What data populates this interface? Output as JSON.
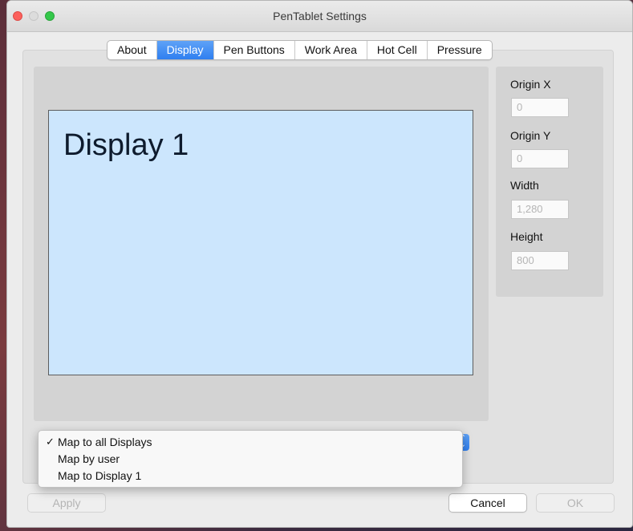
{
  "window": {
    "title": "PenTablet Settings"
  },
  "tabs": [
    {
      "label": "About",
      "active": false
    },
    {
      "label": "Display",
      "active": true
    },
    {
      "label": "Pen Buttons",
      "active": false
    },
    {
      "label": "Work Area",
      "active": false
    },
    {
      "label": "Hot Cell",
      "active": false
    },
    {
      "label": "Pressure",
      "active": false
    }
  ],
  "preview": {
    "display_label": "Display 1"
  },
  "fields": {
    "origin_x": {
      "label": "Origin X",
      "value": "0"
    },
    "origin_y": {
      "label": "Origin Y",
      "value": "0"
    },
    "width": {
      "label": "Width",
      "value": "1,280"
    },
    "height": {
      "label": "Height",
      "value": "800"
    }
  },
  "mapping_menu": {
    "items": [
      {
        "label": "Map to all Displays",
        "checked": true,
        "check_glyph": "✓"
      },
      {
        "label": "Map by user",
        "checked": false,
        "check_glyph": ""
      },
      {
        "label": "Map to Display 1",
        "checked": false,
        "check_glyph": ""
      }
    ]
  },
  "buttons": {
    "apply": "Apply",
    "cancel": "Cancel",
    "ok": "OK"
  },
  "colors": {
    "accent": "#2f7ff0",
    "display_fill": "#cce6fd",
    "close": "#fc605c",
    "zoom": "#34c84a"
  }
}
